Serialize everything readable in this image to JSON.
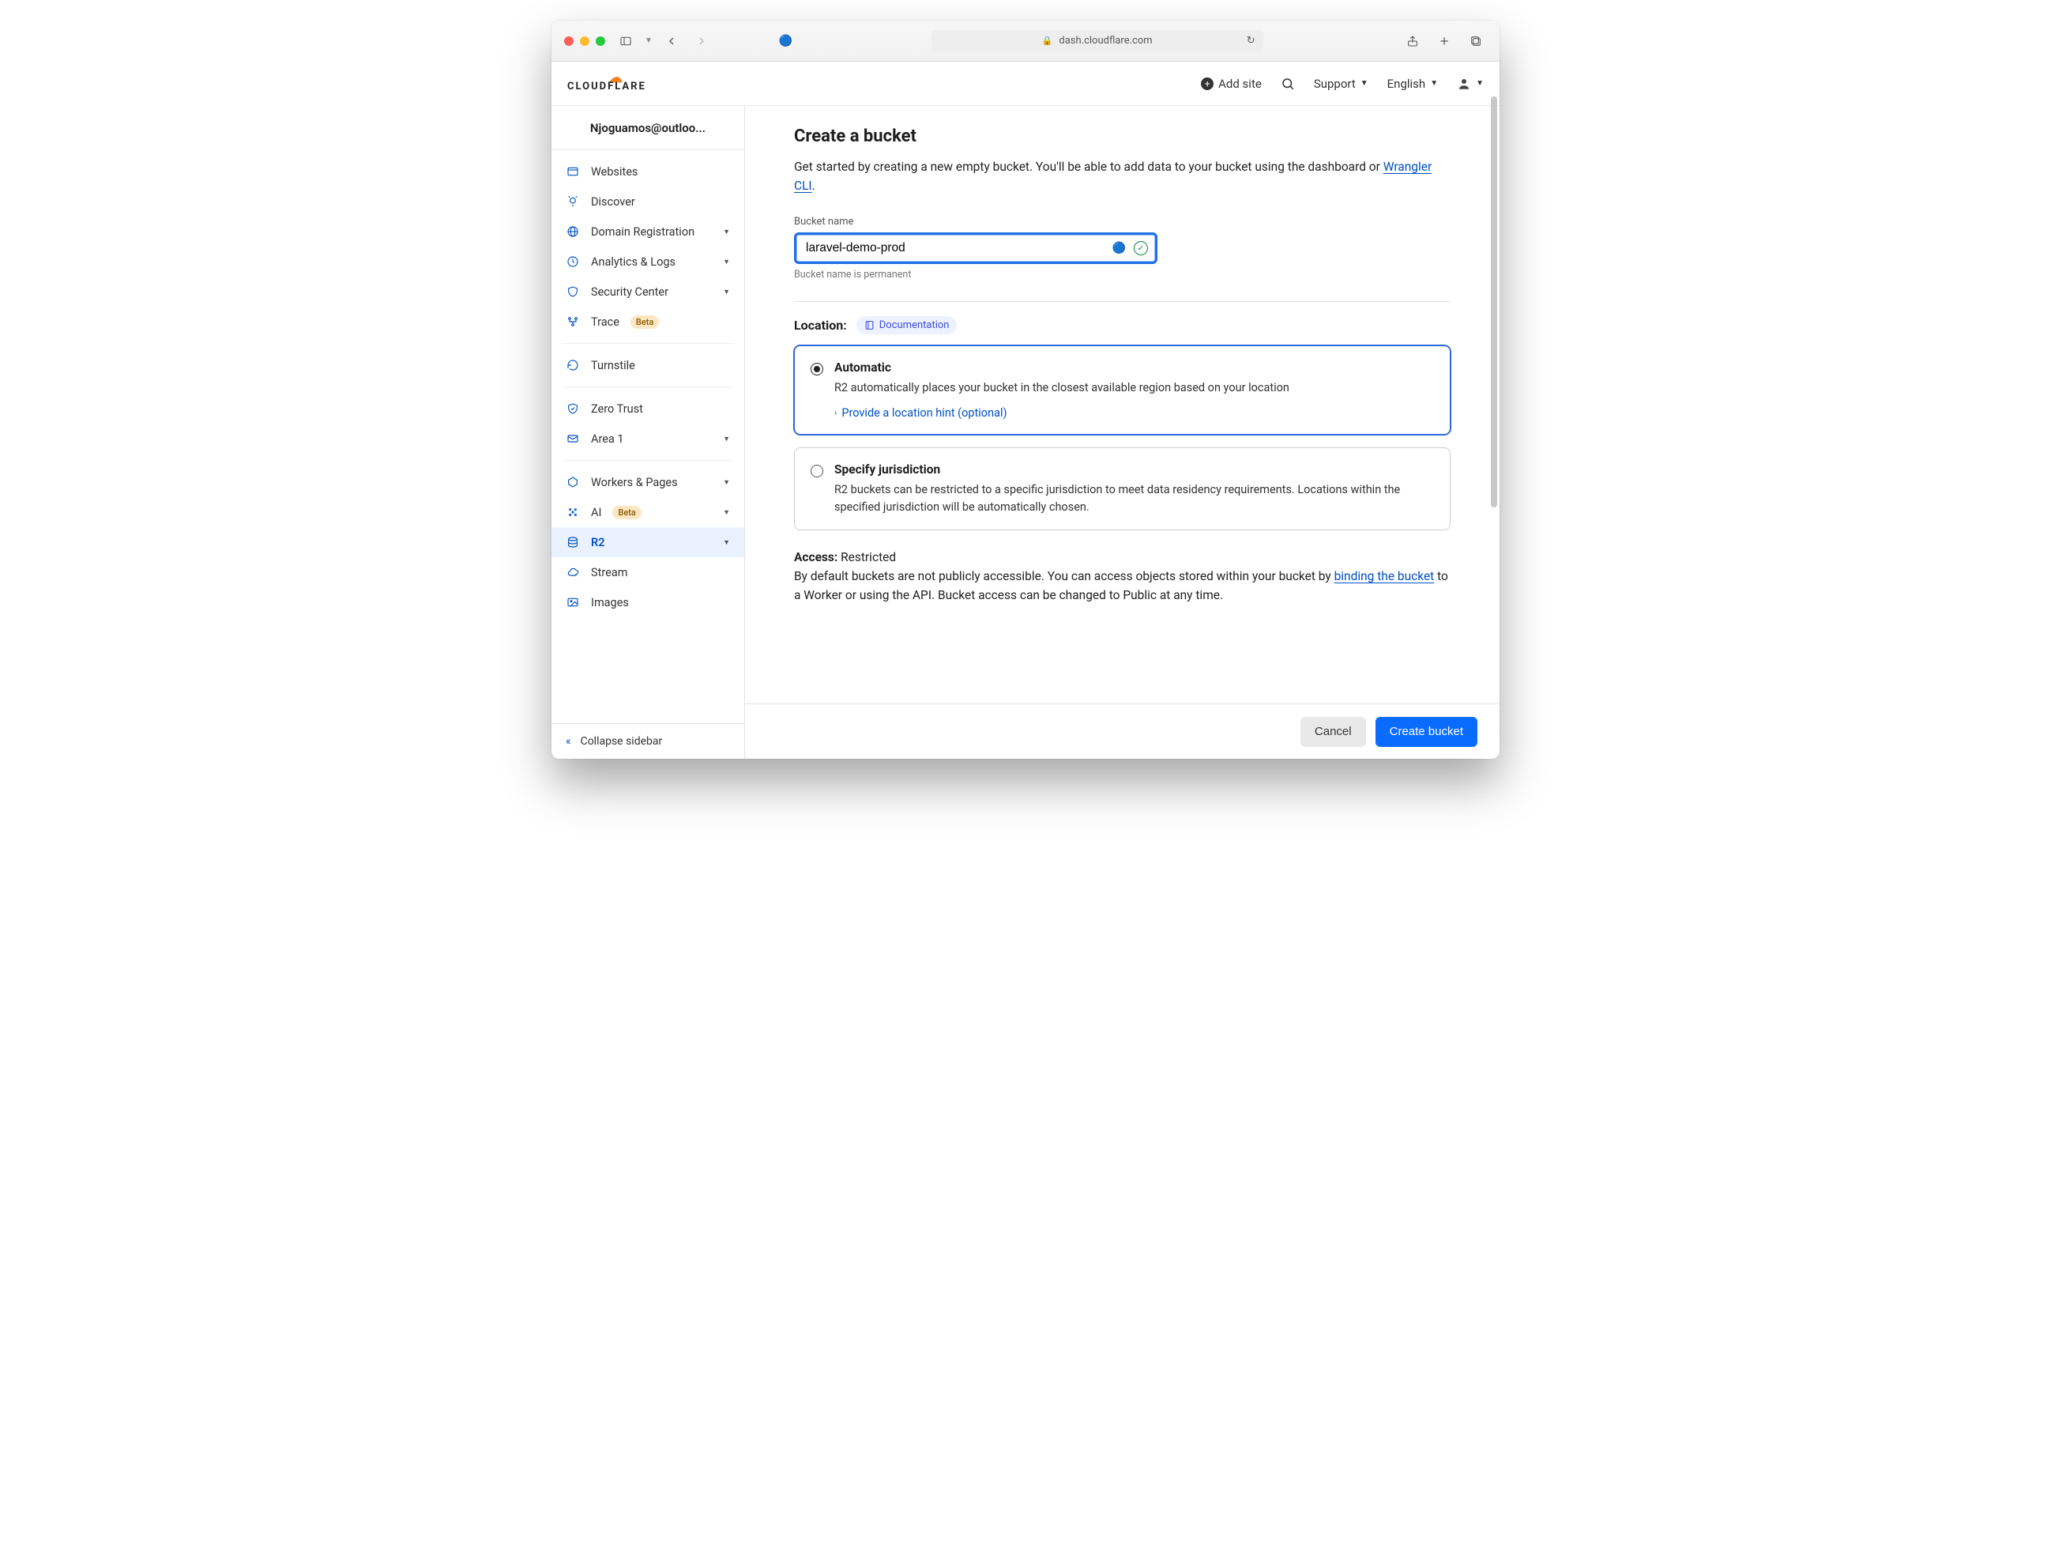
{
  "browser": {
    "url": "dash.cloudflare.com"
  },
  "header": {
    "brand": "CLOUDFLARE",
    "add_site": "Add site",
    "support": "Support",
    "language": "English"
  },
  "sidebar": {
    "account": "Njoguamos@outloo...",
    "collapse": "Collapse sidebar",
    "items": [
      {
        "label": "Websites",
        "icon": "window"
      },
      {
        "label": "Discover",
        "icon": "bulb"
      },
      {
        "label": "Domain Registration",
        "icon": "globe",
        "expandable": true
      },
      {
        "label": "Analytics & Logs",
        "icon": "clock",
        "expandable": true
      },
      {
        "label": "Security Center",
        "icon": "shield",
        "expandable": true
      },
      {
        "label": "Trace",
        "icon": "trace",
        "badge": "Beta"
      },
      {
        "sep": true
      },
      {
        "label": "Turnstile",
        "icon": "refresh"
      },
      {
        "sep": true
      },
      {
        "label": "Zero Trust",
        "icon": "zerotrust"
      },
      {
        "label": "Area 1",
        "icon": "mail",
        "expandable": true
      },
      {
        "sep": true
      },
      {
        "label": "Workers & Pages",
        "icon": "workers",
        "expandable": true
      },
      {
        "label": "AI",
        "icon": "ai",
        "badge": "Beta",
        "expandable": true
      },
      {
        "label": "R2",
        "icon": "db",
        "expandable": true,
        "active": true
      },
      {
        "label": "Stream",
        "icon": "cloud"
      },
      {
        "label": "Images",
        "icon": "image"
      }
    ]
  },
  "main": {
    "title": "Create a bucket",
    "intro_prefix": "Get started by creating a new empty bucket. You'll be able to add data to your bucket using the dashboard or ",
    "intro_link": "Wrangler CLI",
    "intro_suffix": ".",
    "bucket_label": "Bucket name",
    "bucket_value": "laravel-demo-prod",
    "bucket_hint": "Bucket name is permanent",
    "location_label": "Location:",
    "doc_pill": "Documentation",
    "opt_auto_title": "Automatic",
    "opt_auto_desc": "R2 automatically places your bucket in the closest available region based on your location",
    "opt_auto_link": "Provide a location hint (optional)",
    "opt_juris_title": "Specify jurisdiction",
    "opt_juris_desc": "R2 buckets can be restricted to a specific jurisdiction to meet data residency requirements. Locations within the specified jurisdiction will be automatically chosen.",
    "access_label": "Access:",
    "access_value": "Restricted",
    "access_desc_prefix": "By default buckets are not publicly accessible. You can access objects stored within your bucket by ",
    "access_link": "binding the bucket",
    "access_desc_suffix": " to a Worker or using the API. Bucket access can be changed to Public at any time.",
    "cancel": "Cancel",
    "create": "Create bucket"
  }
}
